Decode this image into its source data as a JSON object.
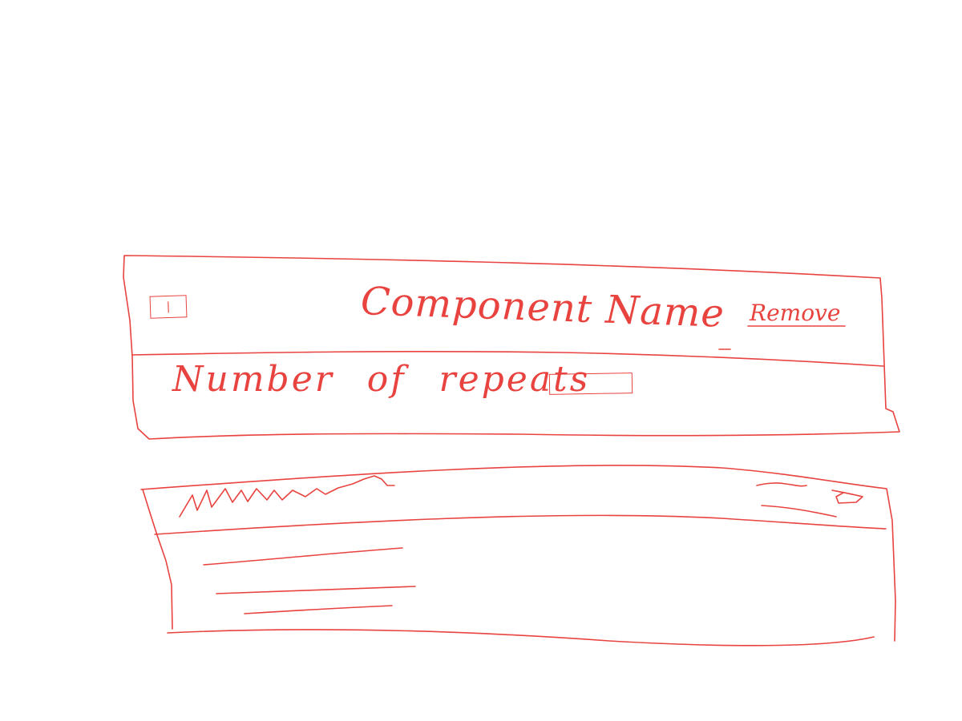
{
  "component": {
    "handle_icon": "drag-handle-icon",
    "handle_glyph": "|",
    "name": "Component Name",
    "remove_label": "Remove",
    "repeats_label": "Number of repeats",
    "repeats_value": ""
  },
  "second_component": {
    "title_icon": "scribble-title-placeholder",
    "action_icons": [
      "scribble-label-placeholder",
      "small-box-icon"
    ]
  },
  "ink_color": "#e8433f"
}
